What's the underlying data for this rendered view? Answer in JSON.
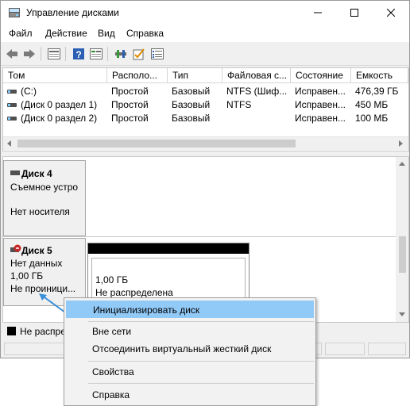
{
  "window": {
    "title": "Управление дисками",
    "controls": {
      "minimize": "minimize-icon",
      "maximize": "maximize-icon",
      "close": "close-icon"
    }
  },
  "menu": [
    "Файл",
    "Действие",
    "Вид",
    "Справка"
  ],
  "toolbar": {
    "icons": [
      "back-arrow-icon",
      "forward-arrow-icon",
      "list-view-icon",
      "help-icon",
      "properties-icon",
      "connect-icon",
      "check-icon",
      "list-icon"
    ]
  },
  "volumes": {
    "columns": [
      "Том",
      "Располо...",
      "Тип",
      "Файловая с...",
      "Состояние",
      "Емкость"
    ],
    "rows": [
      [
        "(C:)",
        "Простой",
        "Базовый",
        "NTFS (Шиф...",
        "Исправен...",
        "476,39 ГБ"
      ],
      [
        "(Диск 0 раздел 1)",
        "Простой",
        "Базовый",
        "NTFS",
        "Исправен...",
        "450 МБ"
      ],
      [
        "(Диск 0 раздел 2)",
        "Простой",
        "Базовый",
        "",
        "Исправен...",
        "100 МБ"
      ]
    ]
  },
  "disks": {
    "disk4": {
      "title": "Диск 4",
      "type": "Съемное устро",
      "status": "Нет носителя"
    },
    "disk5": {
      "title": "Диск 5",
      "line1": "Нет данных",
      "line2": "1,00 ГБ",
      "line3": "Не проиници...",
      "partition_size": "1,00 ГБ",
      "partition_status": "Не распределена"
    }
  },
  "legend": {
    "label": "Не распре",
    "color": "#000000"
  },
  "context_menu": {
    "items": [
      "Инициализировать диск",
      "Вне сети",
      "Отсоединить виртуальный жесткий диск",
      "Свойства",
      "Справка"
    ],
    "highlight_color": "#91c9f7"
  },
  "colors": {
    "accent": "#91c9f7",
    "arrow": "#3a8fd8",
    "error_badge": "#c62828"
  }
}
